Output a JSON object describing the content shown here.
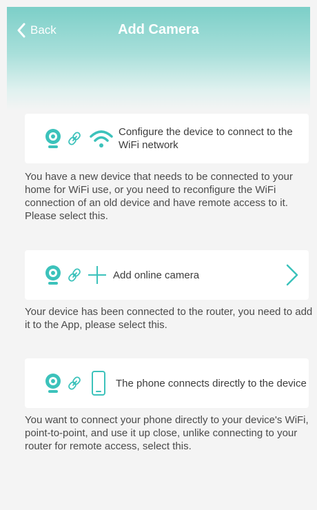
{
  "header": {
    "back_label": "Back",
    "title": "Add Camera"
  },
  "options": [
    {
      "label": "Configure the device to connect to the WiFi network",
      "description": "You have a new device that needs to be connected to your home for WiFi use, or you need to reconfigure the WiFi connection of an old device and have remote access to it. Please select this.",
      "icons": [
        "camera-icon",
        "link-icon",
        "wifi-icon"
      ]
    },
    {
      "label": "Add online camera",
      "description": "Your device has been connected to the router, you need to add it to the App, please select this.",
      "icons": [
        "camera-icon",
        "link-icon",
        "plus-icon",
        "chevron-right-icon"
      ]
    },
    {
      "label": "The phone connects directly to the device",
      "description": "You want to connect your phone directly to your device's WiFi, point-to-point, and use it up close, unlike connecting to your router for remote access, select this.",
      "icons": [
        "camera-icon",
        "link-icon",
        "phone-icon"
      ]
    }
  ],
  "colors": {
    "accent": "#3cc2bb",
    "header_gradient_top": "#7ccfc8",
    "background": "#f4f4f4"
  }
}
